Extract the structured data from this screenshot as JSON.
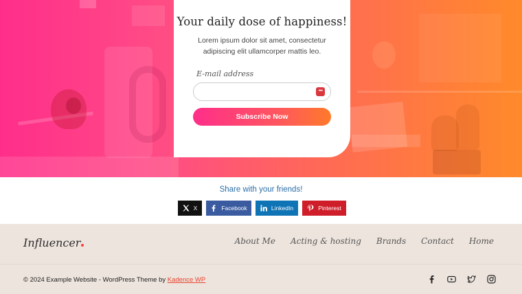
{
  "newsletter": {
    "title": "Your daily dose of happiness!",
    "description": "Lorem ipsum dolor sit amet, consectetur adipiscing elit ullamcorper mattis leo.",
    "email_label": "E-mail address",
    "email_value": "",
    "email_placeholder": "",
    "subscribe_label": "Subscribe Now"
  },
  "share": {
    "title": "Share with your friends!",
    "buttons": [
      {
        "label": "X",
        "icon": "x-icon",
        "color": "#111111"
      },
      {
        "label": "Facebook",
        "icon": "facebook-icon",
        "color": "#3b5ba0"
      },
      {
        "label": "LinkedIn",
        "icon": "linkedin-icon",
        "color": "#0f74b5"
      },
      {
        "label": "Pinterest",
        "icon": "pinterest-icon",
        "color": "#cf1e2a"
      }
    ]
  },
  "footer": {
    "logo": "Influencer",
    "logo_accent_color": "#ff3b3b",
    "nav": [
      "About Me",
      "Acting & hosting",
      "Brands",
      "Contact",
      "Home"
    ],
    "copyright_prefix": "© 2024 Example Website - WordPress Theme by ",
    "copyright_link": "Kadence WP",
    "social": [
      "facebook-icon",
      "youtube-icon",
      "twitter-icon",
      "instagram-icon"
    ]
  },
  "colors": {
    "hero_gradient_start": "#ff2e8a",
    "hero_gradient_end": "#ff8a2a",
    "footer_bg": "#ede4dd",
    "link_accent": "#e8432f"
  }
}
